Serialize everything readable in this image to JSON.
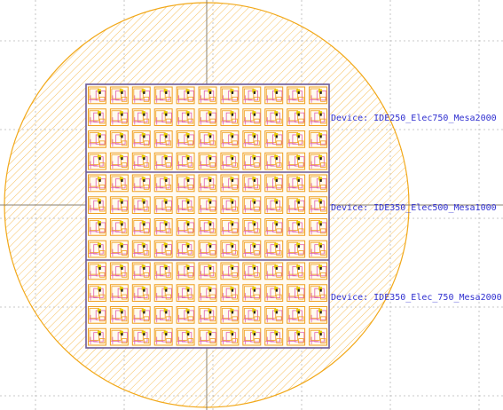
{
  "colors": {
    "background": "#ffffff",
    "grid": "#b8b8b8",
    "crosshair": "#8a8070",
    "wafer_stroke": "#f2a818",
    "wafer_hatch": "#f6c060",
    "die_outline": "#6a5a9a",
    "cell_orange": "#f0a020",
    "cell_pink": "#e060b0",
    "cell_yellow": "#e8d000",
    "cell_black": "#222222",
    "label_text": "#3030d0"
  },
  "layout": {
    "wafer_shape": "circle",
    "crosshair": true,
    "grid": "dotted",
    "die_columns": 11,
    "die_rows": 12,
    "device_groups": 3
  },
  "device_labels": [
    {
      "text": "Device: IDE250_Elec750_Mesa2000"
    },
    {
      "text": "Device: IDE350_Elec500_Mesa1000"
    },
    {
      "text": "Device: IDE350_Elec_750_Mesa2000"
    }
  ]
}
